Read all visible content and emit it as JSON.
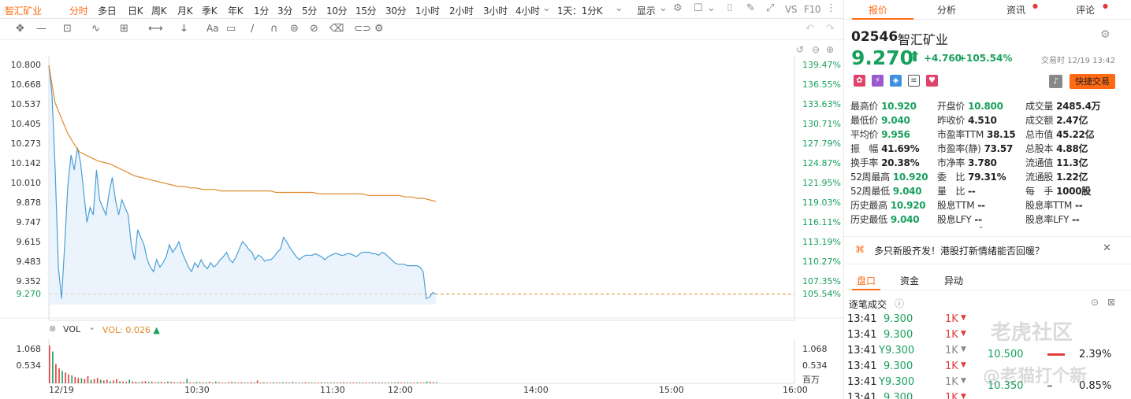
{
  "toolbar": {
    "name": "智汇矿业",
    "timeframes": [
      "分时",
      "多日",
      "日K",
      "周K",
      "月K",
      "季K",
      "年K",
      "1分",
      "3分",
      "5分",
      "10分",
      "15分",
      "30分",
      "1小时",
      "2小时",
      "3小时",
      "4小时"
    ],
    "interval": "1天：1分K",
    "display": "显示",
    "vs": "VS",
    "f10": "F10"
  },
  "stock": {
    "code": "02546",
    "name": "智汇矿业",
    "price": "9.270",
    "change": "+4.760",
    "change_pct": "+105.54%",
    "time_label": "交易时 12/19 13:42",
    "quick_trade": "快捷交易"
  },
  "tabs": [
    "报价",
    "分析",
    "资讯",
    "评论"
  ],
  "stats": [
    [
      {
        "k": "最高价",
        "v": "10.920",
        "c": "green"
      },
      {
        "k": "开盘价",
        "v": "10.800",
        "c": "green"
      },
      {
        "k": "成交量",
        "v": "2485.4万",
        "c": "dark"
      }
    ],
    [
      {
        "k": "最低价",
        "v": "9.040",
        "c": "green"
      },
      {
        "k": "昨收价",
        "v": "4.510",
        "c": "dark"
      },
      {
        "k": "成交额",
        "v": "2.47亿",
        "c": "dark"
      }
    ],
    [
      {
        "k": "平均价",
        "v": "9.956",
        "c": "green"
      },
      {
        "k": "市盈率TTM",
        "v": "38.15",
        "c": "dark"
      },
      {
        "k": "总市值",
        "v": "45.22亿",
        "c": "dark"
      }
    ],
    [
      {
        "k": "振　幅",
        "v": "41.69%",
        "c": "dark"
      },
      {
        "k": "市盈率(静)",
        "v": "73.57",
        "c": "dark"
      },
      {
        "k": "总股本",
        "v": "4.88亿",
        "c": "dark"
      }
    ],
    [
      {
        "k": "换手率",
        "v": "20.38%",
        "c": "dark"
      },
      {
        "k": "市净率",
        "v": "3.780",
        "c": "dark"
      },
      {
        "k": "流通值",
        "v": "11.3亿",
        "c": "dark"
      }
    ],
    [
      {
        "k": "52周最高",
        "v": "10.920",
        "c": "green"
      },
      {
        "k": "委　比",
        "v": "79.31%",
        "c": "dark"
      },
      {
        "k": "流通股",
        "v": "1.22亿",
        "c": "dark"
      }
    ],
    [
      {
        "k": "52周最低",
        "v": "9.040",
        "c": "green"
      },
      {
        "k": "量　比",
        "v": "--",
        "c": "dark"
      },
      {
        "k": "每　手",
        "v": "1000股",
        "c": "dark"
      }
    ],
    [
      {
        "k": "历史最高",
        "v": "10.920",
        "c": "green"
      },
      {
        "k": "股息TTM",
        "v": "--",
        "c": "dark"
      },
      {
        "k": "股息率TTM",
        "v": "--",
        "c": "dark"
      }
    ],
    [
      {
        "k": "历史最低",
        "v": "9.040",
        "c": "green"
      },
      {
        "k": "股息LFY",
        "v": "--",
        "c": "dark"
      },
      {
        "k": "股息率LFY",
        "v": "--",
        "c": "dark"
      }
    ]
  ],
  "news": "多只新股齐发！港股打新情绪能否回暖？",
  "subtabs": [
    "盘口",
    "资金",
    "异动"
  ],
  "trades_title": "逐笔成交",
  "trades": [
    {
      "t": "13:41",
      "p": "9.300",
      "s": "1K"
    },
    {
      "t": "13:41",
      "p": "9.300",
      "s": "1K"
    },
    {
      "t": "13:41",
      "p": "Y9.300",
      "s": "1K"
    },
    {
      "t": "13:41",
      "p": "9.300",
      "s": "1K"
    },
    {
      "t": "13:41",
      "p": "Y9.300",
      "s": "1K"
    },
    {
      "t": "13:41",
      "p": "9.300",
      "s": "1K"
    }
  ],
  "depth": [
    {
      "p": "10.500",
      "pct": "2.39%"
    },
    {
      "p": "10.350",
      "pct": "0.85%"
    }
  ],
  "watermark1": "老虎社区",
  "watermark2": "@老猫打个新",
  "chart_data": {
    "type": "line",
    "y_ticks": [
      "10.800",
      "10.668",
      "10.537",
      "10.405",
      "10.273",
      "10.142",
      "10.010",
      "9.878",
      "9.747",
      "9.615",
      "9.483",
      "9.352",
      "9.270"
    ],
    "y_pct_ticks": [
      "139.47%",
      "136.55%",
      "133.63%",
      "130.71%",
      "127.79%",
      "124.87%",
      "121.95%",
      "119.03%",
      "116.11%",
      "113.19%",
      "110.27%",
      "107.35%",
      "105.54%"
    ],
    "x_ticks": [
      "12/19",
      "10:30",
      "11:30",
      "12:00",
      "14:00",
      "15:00",
      "16:00"
    ],
    "vol_label": "VOL",
    "vol_value": "VOL: 0.026",
    "vol_ticks": [
      "1.068",
      "0.534"
    ],
    "vol_ticks_right": [
      "1.068",
      "0.534",
      "百万"
    ],
    "ylim": [
      9.2,
      10.8
    ],
    "price": [
      10.8,
      10.6,
      10.1,
      9.45,
      9.24,
      9.6,
      10.0,
      10.2,
      10.1,
      10.25,
      10.15,
      9.95,
      9.75,
      9.85,
      9.8,
      10.1,
      9.9,
      9.85,
      9.8,
      9.95,
      10.05,
      9.9,
      9.8,
      9.9,
      9.85,
      9.8,
      9.6,
      9.5,
      9.7,
      9.65,
      9.6,
      9.5,
      9.45,
      9.42,
      9.5,
      9.45,
      9.48,
      9.52,
      9.6,
      9.55,
      9.58,
      9.62,
      9.55,
      9.5,
      9.45,
      9.42,
      9.48,
      9.45,
      9.5,
      9.46,
      9.44,
      9.48,
      9.45,
      9.47,
      9.5,
      9.52,
      9.55,
      9.5,
      9.48,
      9.52,
      9.57,
      9.62,
      9.6,
      9.57,
      9.55,
      9.5,
      9.53,
      9.52,
      9.49,
      9.5,
      9.5,
      9.52,
      9.55,
      9.57,
      9.65,
      9.62,
      9.58,
      9.55,
      9.52,
      9.5,
      9.52,
      9.53,
      9.53,
      9.53,
      9.54,
      9.53,
      9.52,
      9.5,
      9.52,
      9.53,
      9.54,
      9.54,
      9.53,
      9.53,
      9.54,
      9.54,
      9.53,
      9.52,
      9.54,
      9.55,
      9.55,
      9.55,
      9.54,
      9.54,
      9.53,
      9.55,
      9.54,
      9.52,
      9.5,
      9.48,
      9.47,
      9.47,
      9.47,
      9.46,
      9.46,
      9.46,
      9.46,
      9.45,
      9.42,
      9.24,
      9.25,
      9.28,
      9.27
    ],
    "avg": [
      10.8,
      10.55,
      10.45,
      10.35,
      10.28,
      10.22,
      10.2,
      10.18,
      10.16,
      10.15,
      10.14,
      10.12,
      10.1,
      10.08,
      10.06,
      10.05,
      10.04,
      10.03,
      10.02,
      10.01,
      10.0,
      9.99,
      9.99,
      9.98,
      9.98,
      9.97,
      9.97,
      9.97,
      9.96,
      9.96,
      9.96,
      9.96,
      9.96,
      9.96,
      9.96,
      9.96,
      9.96,
      9.95,
      9.95,
      9.95,
      9.95,
      9.95,
      9.95,
      9.95,
      9.94,
      9.94,
      9.94,
      9.94,
      9.94,
      9.94,
      9.94,
      9.94,
      9.93,
      9.93,
      9.93,
      9.93,
      9.93,
      9.93,
      9.92,
      9.92,
      9.91,
      9.91,
      9.9,
      9.89
    ],
    "volume": [
      1.068,
      0.9,
      0.55,
      0.42,
      0.35,
      0.3,
      0.25,
      0.22,
      0.18,
      0.15,
      0.14,
      0.12,
      0.2,
      0.1,
      0.12,
      0.15,
      0.1,
      0.08,
      0.1,
      0.06,
      0.08,
      0.12,
      0.06,
      0.05,
      0.04,
      0.1,
      0.05,
      0.04,
      0.03,
      0.05,
      0.06,
      0.04,
      0.05,
      0.03,
      0.04,
      0.04,
      0.03,
      0.05,
      0.04,
      0.03,
      0.02,
      0.04,
      0.03,
      0.12,
      0.03,
      0.02,
      0.04,
      0.03,
      0.02,
      0.03,
      0.04,
      0.02,
      0.05,
      0.03,
      0.02,
      0.02,
      0.03,
      0.04,
      0.03,
      0.02,
      0.03,
      0.02,
      0.02,
      0.03,
      0.02,
      0.08,
      0.02,
      0.03,
      0.02,
      0.02,
      0.03,
      0.02,
      0.02,
      0.03,
      0.02,
      0.02,
      0.04,
      0.02,
      0.02,
      0.02,
      0.03,
      0.02,
      0.02,
      0.02,
      0.02,
      0.03,
      0.02,
      0.02,
      0.02,
      0.02,
      0.02,
      0.02,
      0.03,
      0.02,
      0.02,
      0.02,
      0.02,
      0.02,
      0.02,
      0.02,
      0.02,
      0.02,
      0.02,
      0.02,
      0.02,
      0.02,
      0.02,
      0.02,
      0.02,
      0.03,
      0.02,
      0.02,
      0.02,
      0.02,
      0.02,
      0.03,
      0.02,
      0.02,
      0.05,
      0.04,
      0.03,
      0.03
    ],
    "colors": {
      "price": "#4a9fd8",
      "avg": "#e08a2c",
      "up": "#e03c3c",
      "down": "#19a05d",
      "prev_close": "#e08a2c"
    }
  }
}
